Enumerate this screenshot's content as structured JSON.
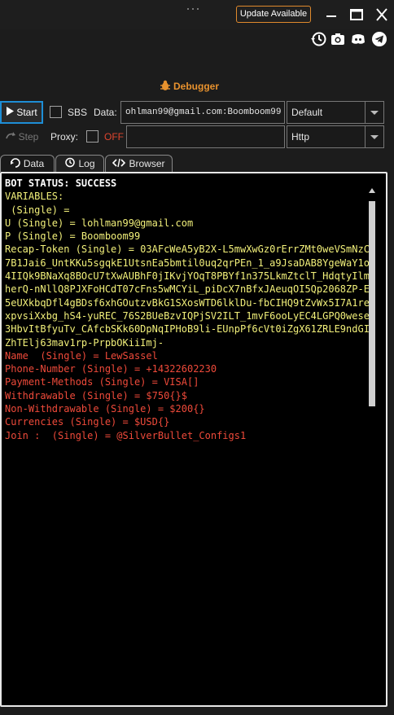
{
  "header": {
    "update_label": "Update Available"
  },
  "debugger": {
    "title": "Debugger"
  },
  "controls": {
    "start_label": "Start",
    "sbs_label": "SBS",
    "data_label": "Data:",
    "data_value": "ohlman99@gmail.com:Boomboom99",
    "wordlist_type": "Default",
    "step_label": "Step",
    "proxy_label": "Proxy:",
    "proxy_state": "OFF",
    "proxy_value": "",
    "proxy_type": "Http"
  },
  "tabs": [
    {
      "label": "Data"
    },
    {
      "label": "Log"
    },
    {
      "label": "Browser"
    }
  ],
  "output": {
    "lines": [
      {
        "text": "BOT STATUS: SUCCESS",
        "color": "white"
      },
      {
        "text": "VARIABLES:",
        "color": "yellow"
      },
      {
        "text": " (Single) = ",
        "color": "yellow"
      },
      {
        "text": "U (Single) = lohlman99@gmail.com",
        "color": "yellow"
      },
      {
        "text": "P (Single) = Boomboom99",
        "color": "yellow"
      },
      {
        "text": "Recap-Token (Single) = 03AFcWeA5yB2X-L5mwXwGz0rErrZMt0weVSmNzC7B1Jai6_UntKKu5sgqkE1UtsnEa5bmtil0uq2qrPEn_1_a9JsaDAB8YgeWaY1o4IIQk9BNaXq8BOcU7tXwAUBhF0jIKvjYOqT8PBYf1n375LkmZtclT_HdqtyIlmherQ-nNllQ8PJXFoHCdT07cFns5wMCYiL_piDcX7nBfxJAeuqOI5Qp2068ZP-E5eUXkbqDfl4gBDsf6xhGOutzvBkG1SXosWTD6lklDu-fbCIHQ9tZvWx5I7A1rexpvsiXxbg_hS4-yuREC_76S2BUeBzvIQPjSV2ILT_1mvF6ooLyEC4LGPQ0wese3HbvItBfyuTv_CAfcbSKk60DpNqIPHoB9li-EUnpPf6cVt0iZgX61ZRLE9ndGIZhTElj63mav1rp-PrpbOKiiImj-",
        "color": "yellow"
      },
      {
        "text": "Name  (Single) = LewSassel",
        "color": "red"
      },
      {
        "text": "Phone-Number (Single) = +14322602230",
        "color": "red"
      },
      {
        "text": "Payment-Methods (Single) = VISA[]",
        "color": "red"
      },
      {
        "text": "Withdrawable (Single) = $750{}$",
        "color": "red"
      },
      {
        "text": "Non-Withdrawable (Single) = $200{}",
        "color": "red"
      },
      {
        "text": "Currencies (Single) = $USD{}",
        "color": "red"
      },
      {
        "text": "Join :  (Single) = @SilverBullet_Configs1",
        "color": "red"
      }
    ]
  },
  "icons": {
    "toolbar": [
      "history-icon",
      "camera-icon",
      "discord-icon",
      "telegram-icon"
    ],
    "window": [
      "minimize-icon",
      "maximize-icon",
      "close-icon"
    ]
  },
  "colors": {
    "accent": "#e8922e",
    "focus": "#1e8ed6",
    "status_white": "#ffffff",
    "var_yellow": "#f2f07a",
    "capture_red": "#ef4a3a"
  }
}
